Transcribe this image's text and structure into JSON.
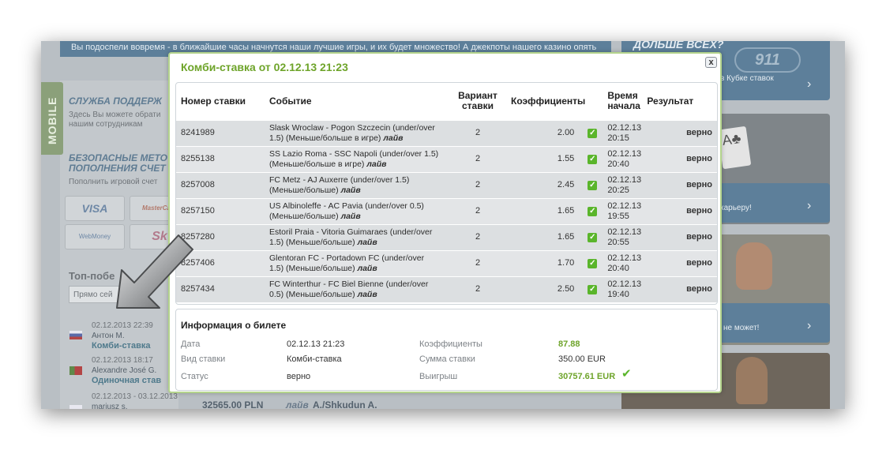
{
  "background": {
    "banner_text": "Вы подоспели вовремя - в ближайшие часы начнутся наши лучшие игры, и их будет множество! А джекпоты нашего казино опять",
    "mobile_tab": "MOBILE",
    "support_title": "СЛУЖБА ПОДДЕРЖ",
    "support_text_1": "Здесь Вы можете обрати",
    "support_text_2": "нашим сотрудникам",
    "payments_title_1": "БЕЗОПАСНЫЕ МЕТО",
    "payments_title_2": "ПОПОЛНЕНИЯ СЧЕТ",
    "payments_text": "Пополнить игровой счет",
    "pay_visa": "VISA",
    "pay_master": "MasterCard",
    "pay_webmoney": "WebMoney",
    "pay_skrill": "Sk",
    "top_winners": "Топ-побе",
    "search_placeholder": "Прямо сей",
    "winners": [
      {
        "date": "02.12.2013 22:39",
        "name": "Антон М.",
        "type": "Комби-ставка"
      },
      {
        "date": "02.12.2013 18:17",
        "name": "Alexandre José G.",
        "type": "Одиночная став"
      },
      {
        "date": "02.12.2013 - 03.12.2013",
        "name": "mariusz s.",
        "amount": "32565.00 PLN"
      }
    ],
    "bottom_live": "лайв",
    "bottom_names": "A./Shkudun A.",
    "right_title": "ДОЛЬШЕ ВСЕХ?",
    "right_badge": "911",
    "right_text_1": "в Кубке ставок",
    "right_text_2": "карьеру!",
    "right_text_3": "не может!"
  },
  "modal": {
    "title": "Комби-ставка от 02.12.13 21:23",
    "close_label": "x",
    "columns": {
      "number": "Номер ставки",
      "event": "Событие",
      "variant_1": "Вариант",
      "variant_2": "ставки",
      "coef": "Коэффициенты",
      "start_1": "Время",
      "start_2": "начала",
      "result": "Результат"
    },
    "bets": [
      {
        "number": "8241989",
        "event_1": "Slask Wroclaw - Pogon Szczecin (under/over",
        "event_2": "1.5) (Меньше/больше в игре)",
        "live": "лайв",
        "variant": "2",
        "coef": "2.00",
        "date": "02.12.13",
        "time": "20:15",
        "result": "верно"
      },
      {
        "number": "8255138",
        "event_1": "SS Lazio Roma - SSC Napoli (under/over 1.5)",
        "event_2": "(Меньше/больше в игре)",
        "live": "лайв",
        "variant": "2",
        "coef": "1.55",
        "date": "02.12.13",
        "time": "20:40",
        "result": "верно"
      },
      {
        "number": "8257008",
        "event_1": "FC Metz - AJ Auxerre (under/over 1.5)",
        "event_2": "(Меньше/больше)",
        "live": "лайв",
        "variant": "2",
        "coef": "2.45",
        "date": "02.12.13",
        "time": "20:25",
        "result": "верно"
      },
      {
        "number": "8257150",
        "event_1": "US Albinoleffe - AC Pavia (under/over 0.5)",
        "event_2": "(Меньше/больше)",
        "live": "лайв",
        "variant": "2",
        "coef": "1.65",
        "date": "02.12.13",
        "time": "19:55",
        "result": "верно"
      },
      {
        "number": "8257280",
        "event_1": "Estoril Praia - Vitoria Guimaraes (under/over",
        "event_2": "1.5) (Меньше/больше)",
        "live": "лайв",
        "variant": "2",
        "coef": "1.65",
        "date": "02.12.13",
        "time": "20:55",
        "result": "верно"
      },
      {
        "number": "8257406",
        "event_1": "Glentoran FC - Portadown FC (under/over",
        "event_2": "1.5) (Меньше/больше)",
        "live": "лайв",
        "variant": "2",
        "coef": "1.70",
        "date": "02.12.13",
        "time": "20:40",
        "result": "верно"
      },
      {
        "number": "8257434",
        "event_1": "FC Winterthur - FC Biel Bienne (under/over",
        "event_2": "0.5) (Меньше/больше)",
        "live": "лайв",
        "variant": "2",
        "coef": "2.50",
        "date": "02.12.13",
        "time": "19:40",
        "result": "верно"
      }
    ],
    "info": {
      "title": "Информация о билете",
      "date_label": "Дата",
      "date_value": "02.12.13 21:23",
      "type_label": "Вид ставки",
      "type_value": "Комби-ставка",
      "status_label": "Статус",
      "status_value": "верно",
      "coef_label": "Коэффициенты",
      "coef_value": "87.88",
      "stake_label": "Сумма ставки",
      "stake_value": "350.00 EUR",
      "win_label": "Выигрыш",
      "win_value": "30757.61 EUR"
    }
  },
  "colors": {
    "accent_green": "#6ea42a",
    "check_green": "#5ab52b",
    "modal_border": "#b4d48c",
    "backdrop": "#b9bfc4"
  }
}
